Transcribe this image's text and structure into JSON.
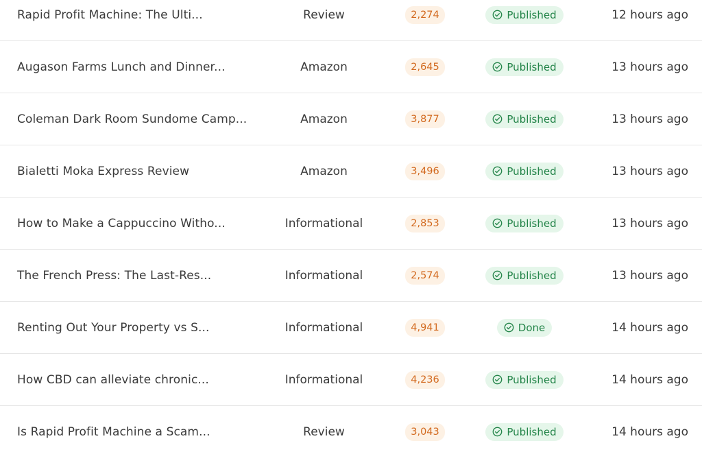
{
  "rows": [
    {
      "title": "Rapid Profit Machine: The Ulti...",
      "type": "Review",
      "words": "2,274",
      "status": "Published",
      "time": "12 hours ago"
    },
    {
      "title": "Augason Farms Lunch and Dinner...",
      "type": "Amazon",
      "words": "2,645",
      "status": "Published",
      "time": "13 hours ago"
    },
    {
      "title": "Coleman Dark Room Sundome Camp...",
      "type": "Amazon",
      "words": "3,877",
      "status": "Published",
      "time": "13 hours ago"
    },
    {
      "title": "Bialetti Moka Express Review",
      "type": "Amazon",
      "words": "3,496",
      "status": "Published",
      "time": "13 hours ago"
    },
    {
      "title": "How to Make a Cappuccino Witho...",
      "type": "Informational",
      "words": "2,853",
      "status": "Published",
      "time": "13 hours ago"
    },
    {
      "title": "The French Press: The Last-Res...",
      "type": "Informational",
      "words": "2,574",
      "status": "Published",
      "time": "13 hours ago"
    },
    {
      "title": "Renting Out Your Property vs S...",
      "type": "Informational",
      "words": "4,941",
      "status": "Done",
      "time": "14 hours ago"
    },
    {
      "title": "How CBD can alleviate chronic...",
      "type": "Informational",
      "words": "4,236",
      "status": "Published",
      "time": "14 hours ago"
    },
    {
      "title": "Is Rapid Profit Machine a Scam...",
      "type": "Review",
      "words": "3,043",
      "status": "Published",
      "time": "14 hours ago"
    }
  ],
  "icons": {
    "status": "check-circle-icon"
  },
  "colors": {
    "words_bg": "#fdf1e4",
    "words_text": "#d2691e",
    "status_bg": "#e5f6ea",
    "status_text": "#25854a"
  }
}
